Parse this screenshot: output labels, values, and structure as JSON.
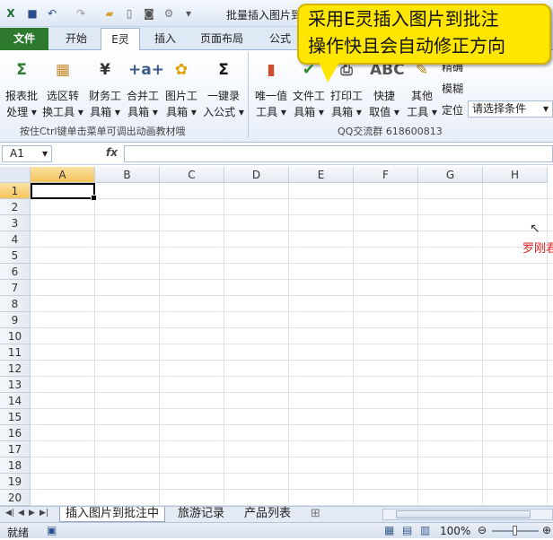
{
  "app": {
    "title": "批量插入图片到"
  },
  "tabs": [
    {
      "label": "文件"
    },
    {
      "label": "开始"
    },
    {
      "label": "E灵"
    },
    {
      "label": "插入"
    },
    {
      "label": "页面布局"
    },
    {
      "label": "公式"
    }
  ],
  "callout": {
    "line1": "采用E灵插入图片到批注",
    "line2": "操作快且会自动修正方向"
  },
  "ribbon": {
    "group1": {
      "label": "按住Ctrl键单击菜单可调出动画教材哦",
      "buttons": [
        {
          "l1": "报表批",
          "l2": "处理",
          "icon": "report-icon",
          "glyph": "Σ",
          "color": "#2d7a2f"
        },
        {
          "l1": "选区转",
          "l2": "换工具",
          "icon": "table-icon",
          "glyph": "▦",
          "color": "#c48b2a"
        },
        {
          "l1": "财务工",
          "l2": "具箱",
          "icon": "yen-icon",
          "glyph": "¥",
          "color": "#333333"
        },
        {
          "l1": "合并工",
          "l2": "具箱",
          "icon": "merge-icon",
          "glyph": "+a+",
          "color": "#3a5c8c"
        },
        {
          "l1": "图片工",
          "l2": "具箱",
          "icon": "sunflower-icon",
          "glyph": "✿",
          "color": "#e0a000"
        },
        {
          "l1": "一键录",
          "l2": "入公式",
          "icon": "sigma-icon",
          "glyph": "Σ",
          "color": "#111111"
        }
      ]
    },
    "group2": {
      "label": "QQ交流群  618600813",
      "buttons": [
        {
          "l1": "唯一值",
          "l2": "工具",
          "icon": "bar-chart-icon",
          "glyph": "▮",
          "color": "#d04a2a"
        },
        {
          "l1": "文件工",
          "l2": "具箱",
          "icon": "checkmark-icon",
          "glyph": "✔",
          "color": "#2d8a2d"
        },
        {
          "l1": "打印工",
          "l2": "具箱",
          "icon": "printer-icon",
          "glyph": "⎙",
          "color": "#555555"
        },
        {
          "l1": "快捷",
          "l2": "取值",
          "icon": "abc-icon",
          "glyph": "ABC",
          "color": "#555555"
        },
        {
          "l1": "其他",
          "l2": "工具",
          "icon": "pencil-icon",
          "glyph": "✎",
          "color": "#b8860b"
        }
      ],
      "small_buttons": [
        {
          "label": "精确"
        },
        {
          "label": "模糊"
        },
        {
          "label": "定位"
        }
      ],
      "dropdown": "请选择条件"
    }
  },
  "formula_bar": {
    "namebox": "A1",
    "fx": "fx",
    "formula": ""
  },
  "columns": [
    "A",
    "B",
    "C",
    "D",
    "E",
    "F",
    "G",
    "H"
  ],
  "rows": [
    "1",
    "2",
    "3",
    "4",
    "5",
    "6",
    "7",
    "8",
    "9",
    "10",
    "11",
    "12",
    "13",
    "14",
    "15",
    "16",
    "17",
    "18",
    "19",
    "20"
  ],
  "overlay_text": "罗刚君",
  "sheets": [
    {
      "label": "插入图片到批注中"
    },
    {
      "label": "旅游记录"
    },
    {
      "label": "产品列表"
    }
  ],
  "status": {
    "ready": "就绪",
    "zoom": "100%"
  }
}
